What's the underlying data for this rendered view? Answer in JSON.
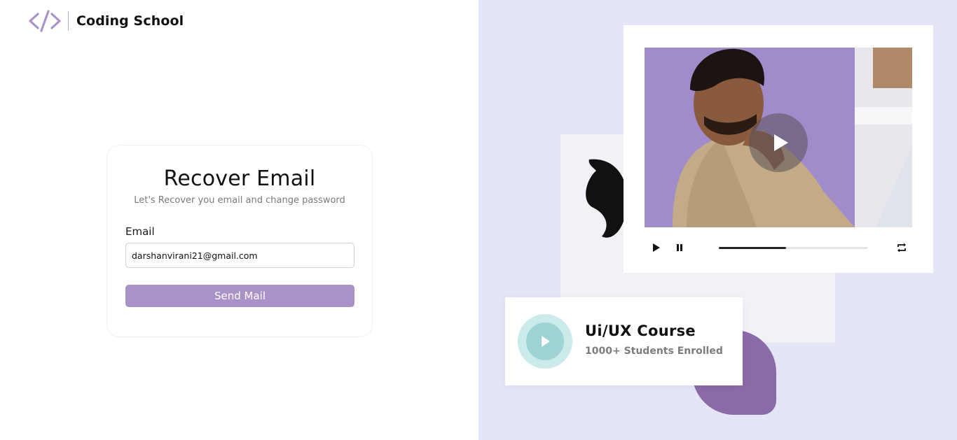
{
  "brand": {
    "name": "Coding School",
    "icon": "code-brackets-icon",
    "color": "#a992c8"
  },
  "recover": {
    "title": "Recover Email",
    "subtitle": "Let's Recover you email and change password",
    "email_label": "Email",
    "email_value": "darshanvirani21@gmail.com",
    "send_label": "Send Mail",
    "button_color": "#a992c8"
  },
  "video": {
    "progress": 0.45,
    "controls": [
      "play-icon",
      "pause-icon",
      "repeat-icon"
    ]
  },
  "course": {
    "title": "Ui/UX Course",
    "subtitle": "1000+ Students Enrolled",
    "icon": "play-icon"
  },
  "colors": {
    "right_bg": "#e5e5f8",
    "accent_purple": "#8b6aa8",
    "teal": "#9dd3d3"
  }
}
